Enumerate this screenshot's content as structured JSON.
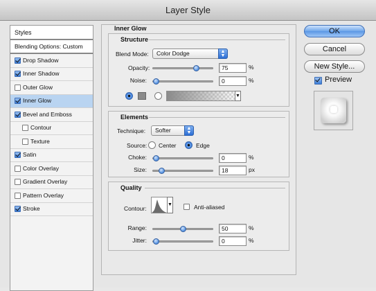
{
  "window": {
    "title": "Layer Style"
  },
  "styles_panel": {
    "header": "Styles",
    "blending_options": "Blending Options: Custom",
    "items": [
      {
        "label": "Drop Shadow",
        "checked": true,
        "selected": false,
        "sub": false
      },
      {
        "label": "Inner Shadow",
        "checked": true,
        "selected": false,
        "sub": false
      },
      {
        "label": "Outer Glow",
        "checked": false,
        "selected": false,
        "sub": false
      },
      {
        "label": "Inner Glow",
        "checked": true,
        "selected": true,
        "sub": false
      },
      {
        "label": "Bevel and Emboss",
        "checked": true,
        "selected": false,
        "sub": false
      },
      {
        "label": "Contour",
        "checked": false,
        "selected": false,
        "sub": true
      },
      {
        "label": "Texture",
        "checked": false,
        "selected": false,
        "sub": true
      },
      {
        "label": "Satin",
        "checked": true,
        "selected": false,
        "sub": false
      },
      {
        "label": "Color Overlay",
        "checked": false,
        "selected": false,
        "sub": false
      },
      {
        "label": "Gradient Overlay",
        "checked": false,
        "selected": false,
        "sub": false
      },
      {
        "label": "Pattern Overlay",
        "checked": false,
        "selected": false,
        "sub": false
      },
      {
        "label": "Stroke",
        "checked": true,
        "selected": false,
        "sub": false
      }
    ]
  },
  "inner_glow": {
    "title": "Inner Glow",
    "structure": {
      "title": "Structure",
      "blend_mode_label": "Blend Mode:",
      "blend_mode_value": "Color Dodge",
      "opacity_label": "Opacity:",
      "opacity_value": "75",
      "opacity_unit": "%",
      "opacity_level": 0.75,
      "noise_label": "Noise:",
      "noise_value": "0",
      "noise_unit": "%",
      "noise_level": 0.0
    },
    "elements": {
      "title": "Elements",
      "technique_label": "Technique:",
      "technique_value": "Softer",
      "source_label": "Source:",
      "source_center": "Center",
      "source_edge": "Edge",
      "choke_label": "Choke:",
      "choke_value": "0",
      "choke_unit": "%",
      "choke_level": 0.0,
      "size_label": "Size:",
      "size_value": "18",
      "size_unit": "px",
      "size_level": 0.1
    },
    "quality": {
      "title": "Quality",
      "contour_label": "Contour:",
      "anti_aliased_label": "Anti-aliased",
      "range_label": "Range:",
      "range_value": "50",
      "range_unit": "%",
      "range_level": 0.5,
      "jitter_label": "Jitter:",
      "jitter_value": "0",
      "jitter_unit": "%",
      "jitter_level": 0.0
    }
  },
  "buttons": {
    "ok": "OK",
    "cancel": "Cancel",
    "new_style": "New Style...",
    "preview_label": "Preview"
  }
}
